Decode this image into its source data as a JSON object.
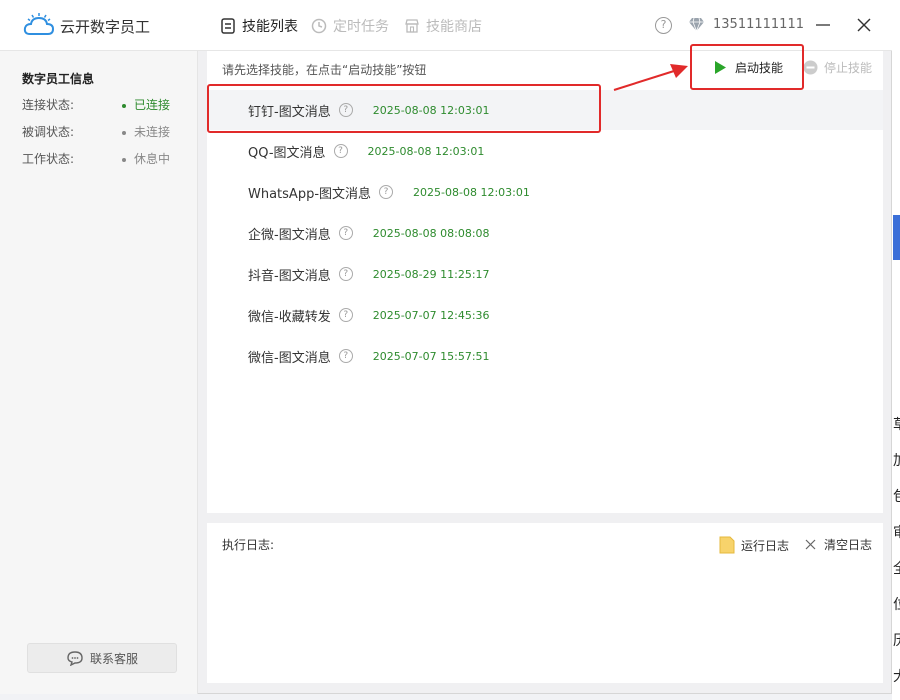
{
  "app": {
    "title": "云开数字员工"
  },
  "tabs": [
    {
      "label": "技能列表",
      "active": true
    },
    {
      "label": "定时任务",
      "active": false
    },
    {
      "label": "技能商店",
      "active": false
    }
  ],
  "user": {
    "phone": "13511111111"
  },
  "sidebar": {
    "title": "数字员工信息",
    "rows": [
      {
        "label": "连接状态:",
        "value": "已连接",
        "color": "#2e8b2e"
      },
      {
        "label": "被调状态:",
        "value": "未连接",
        "color": "#888888"
      },
      {
        "label": "工作状态:",
        "value": "休息中",
        "color": "#888888"
      }
    ],
    "contact_label": "联系客服"
  },
  "main": {
    "hint": "请先选择技能，在点击“启动技能”按钮",
    "start_label": "启动技能",
    "stop_label": "停止技能"
  },
  "skills": [
    {
      "name": "钉钉-图文消息",
      "date": "2025-08-08 12:03:01",
      "selected": true
    },
    {
      "name": "QQ-图文消息",
      "date": "2025-08-08 12:03:01",
      "selected": false
    },
    {
      "name": "WhatsApp-图文消息",
      "date": "2025-08-08 12:03:01",
      "selected": false
    },
    {
      "name": "企微-图文消息",
      "date": "2025-08-08 08:08:08",
      "selected": false
    },
    {
      "name": "抖音-图文消息",
      "date": "2025-08-29 11:25:17",
      "selected": false
    },
    {
      "name": "微信-收藏转发",
      "date": "2025-07-07 12:45:36",
      "selected": false
    },
    {
      "name": "微信-图文消息",
      "date": "2025-07-07 15:57:51",
      "selected": false
    }
  ],
  "log": {
    "title": "执行日志:",
    "run_label": "运行日志",
    "clear_label": "清空日志"
  },
  "colors": {
    "accent_green": "#2e8b2e",
    "annotation_red": "#e12a2a",
    "play_green": "#2aa52a"
  },
  "background_glyphs": [
    "草",
    "加",
    "包",
    "审",
    "全",
    "位",
    "历",
    "大"
  ]
}
